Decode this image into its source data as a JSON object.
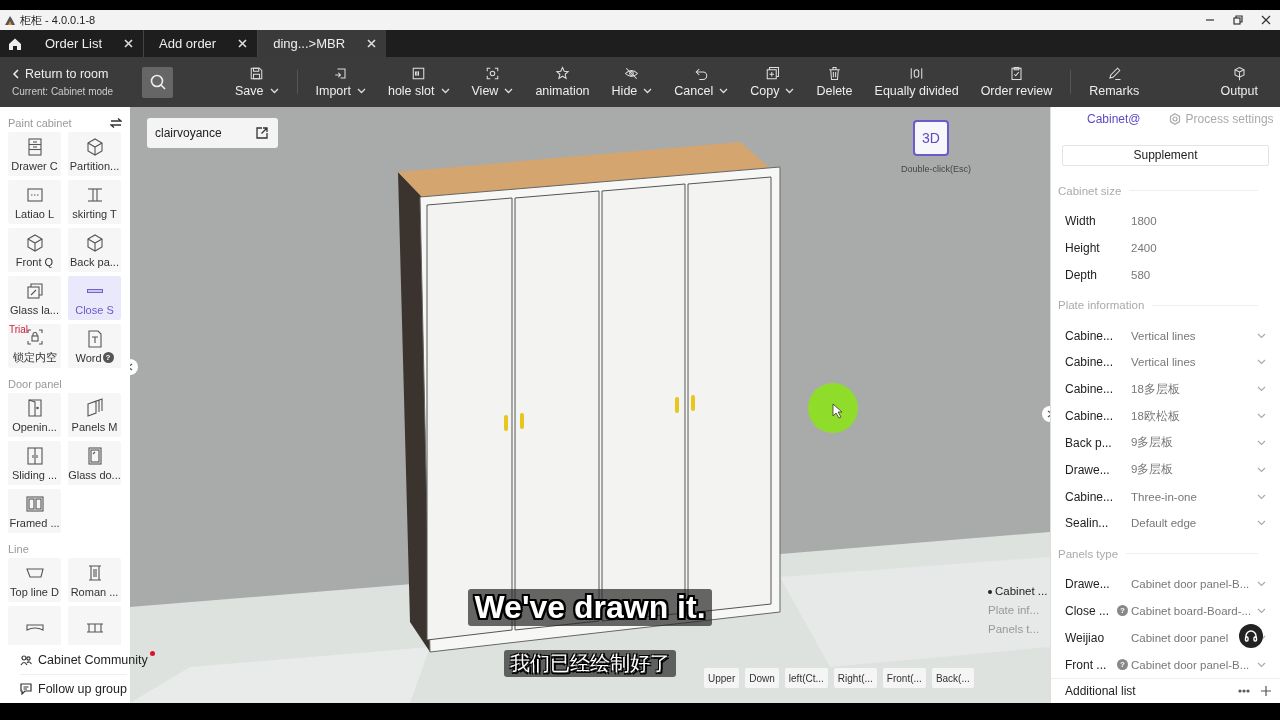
{
  "window": {
    "title": "柜柜 - 4.0.0.1-8"
  },
  "tabs": [
    {
      "label": "Order List",
      "selected": false
    },
    {
      "label": "Add order",
      "selected": false
    },
    {
      "label": "ding...>MBR",
      "selected": true
    }
  ],
  "toolbar": {
    "back": "Return to room",
    "mode": "Current: Cabinet mode",
    "tools": [
      {
        "label": "Save",
        "dropdown": true,
        "separator_after": true
      },
      {
        "label": "Import",
        "dropdown": true,
        "separator_after": false
      },
      {
        "label": "hole slot",
        "dropdown": true,
        "separator_after": false
      },
      {
        "label": "View",
        "dropdown": true,
        "separator_after": false
      },
      {
        "label": "animation",
        "dropdown": false,
        "separator_after": false
      },
      {
        "label": "Hide",
        "dropdown": true,
        "separator_after": false
      },
      {
        "label": "Cancel",
        "dropdown": true,
        "separator_after": false
      },
      {
        "label": "Copy",
        "dropdown": true,
        "separator_after": false
      },
      {
        "label": "Delete",
        "dropdown": false,
        "separator_after": false
      },
      {
        "label": "Equally divided",
        "dropdown": false,
        "separator_after": false
      },
      {
        "label": "Order review",
        "dropdown": false,
        "separator_after": true
      },
      {
        "label": "Remarks",
        "dropdown": false,
        "separator_after": false
      },
      {
        "label": "Output",
        "dropdown": false,
        "separator_after": false
      }
    ]
  },
  "sidebar": {
    "sections": [
      {
        "title": "Paint cabinet",
        "items": [
          {
            "label": "Drawer C",
            "selected": false
          },
          {
            "label": "Partition...",
            "selected": false
          },
          {
            "label": "Latiao L",
            "selected": false
          },
          {
            "label": "skirting T",
            "selected": false
          },
          {
            "label": "Front Q",
            "selected": false
          },
          {
            "label": "Back pa...",
            "selected": false
          },
          {
            "label": "Glass la...",
            "selected": false
          },
          {
            "label": "Close S",
            "selected": true
          },
          {
            "label": "锁定内空",
            "selected": false,
            "badge": {
              "text": "Trial",
              "kind": "trial"
            }
          },
          {
            "label": "Word",
            "selected": false,
            "badge": {
              "text": "?",
              "kind": "help"
            }
          }
        ]
      },
      {
        "title": "Door panel",
        "items": [
          {
            "label": "Openin...",
            "selected": false
          },
          {
            "label": "Panels M",
            "selected": false
          },
          {
            "label": "Sliding ...",
            "selected": false
          },
          {
            "label": "Glass do...",
            "selected": false
          },
          {
            "label": "Framed ...",
            "selected": false
          }
        ]
      },
      {
        "title": "Line",
        "items": [
          {
            "label": "Top line D",
            "selected": false
          },
          {
            "label": "Roman ...",
            "selected": false
          },
          {
            "selected": false
          },
          {
            "selected": false
          }
        ]
      }
    ],
    "footer": [
      {
        "label": "Cabinet Community",
        "dot": true
      },
      {
        "label": "Follow up group",
        "dot": false
      }
    ]
  },
  "viewport": {
    "scheme": "clairvoyance",
    "view_mode": "3D",
    "view_hint": "Double-click(Esc)",
    "outline": [
      {
        "label": "Cabinet ...",
        "selected": true
      },
      {
        "label": "Plate inf...",
        "selected": false
      },
      {
        "label": "Panels t...",
        "selected": false
      }
    ],
    "views": [
      "Upper",
      "Down",
      "left(Ct...",
      "Right(...",
      "Front(...",
      "Back(..."
    ],
    "subtitles": [
      "We've drawn it.",
      "我们已经绘制好了"
    ]
  },
  "panel": {
    "tabs": [
      {
        "label": "Cabinet@",
        "selected": true
      },
      {
        "label": "Process settings",
        "selected": false
      }
    ],
    "supplement": "Supplement",
    "sections": [
      {
        "title": "Cabinet size",
        "rows": [
          {
            "label": "Width",
            "value": "1800",
            "kind": "text"
          },
          {
            "label": "Height",
            "value": "2400",
            "kind": "text"
          },
          {
            "label": "Depth",
            "value": "580",
            "kind": "text"
          }
        ]
      },
      {
        "title": "Plate information",
        "rows": [
          {
            "label": "Cabine...",
            "value": "Vertical lines",
            "kind": "select"
          },
          {
            "label": "Cabine...",
            "value": "Vertical lines",
            "kind": "select"
          },
          {
            "label": "Cabine...",
            "value": "18多层板",
            "kind": "select"
          },
          {
            "label": "Cabine...",
            "value": "18欧松板",
            "kind": "select"
          },
          {
            "label": "Back p...",
            "value": "9多层板",
            "kind": "select"
          },
          {
            "label": "Drawe...",
            "value": "9多层板",
            "kind": "select"
          },
          {
            "label": "Cabine...",
            "value": "Three-in-one",
            "kind": "select"
          },
          {
            "label": "Sealin...",
            "value": "Default edge",
            "kind": "select"
          }
        ]
      },
      {
        "title": "Panels type",
        "rows": [
          {
            "label": "Drawe...",
            "value": "Cabinet door panel-B...",
            "kind": "select"
          },
          {
            "label": "Close ...",
            "note": "?",
            "value": "Cabinet board-Board-...",
            "kind": "select"
          },
          {
            "label": "Weijiao",
            "value": "Cabinet door panel",
            "kind": "select"
          },
          {
            "label": "Front ...",
            "note": "?",
            "value": "Cabinet door panel-B...",
            "kind": "select"
          }
        ]
      }
    ],
    "additional": "Additional list"
  }
}
